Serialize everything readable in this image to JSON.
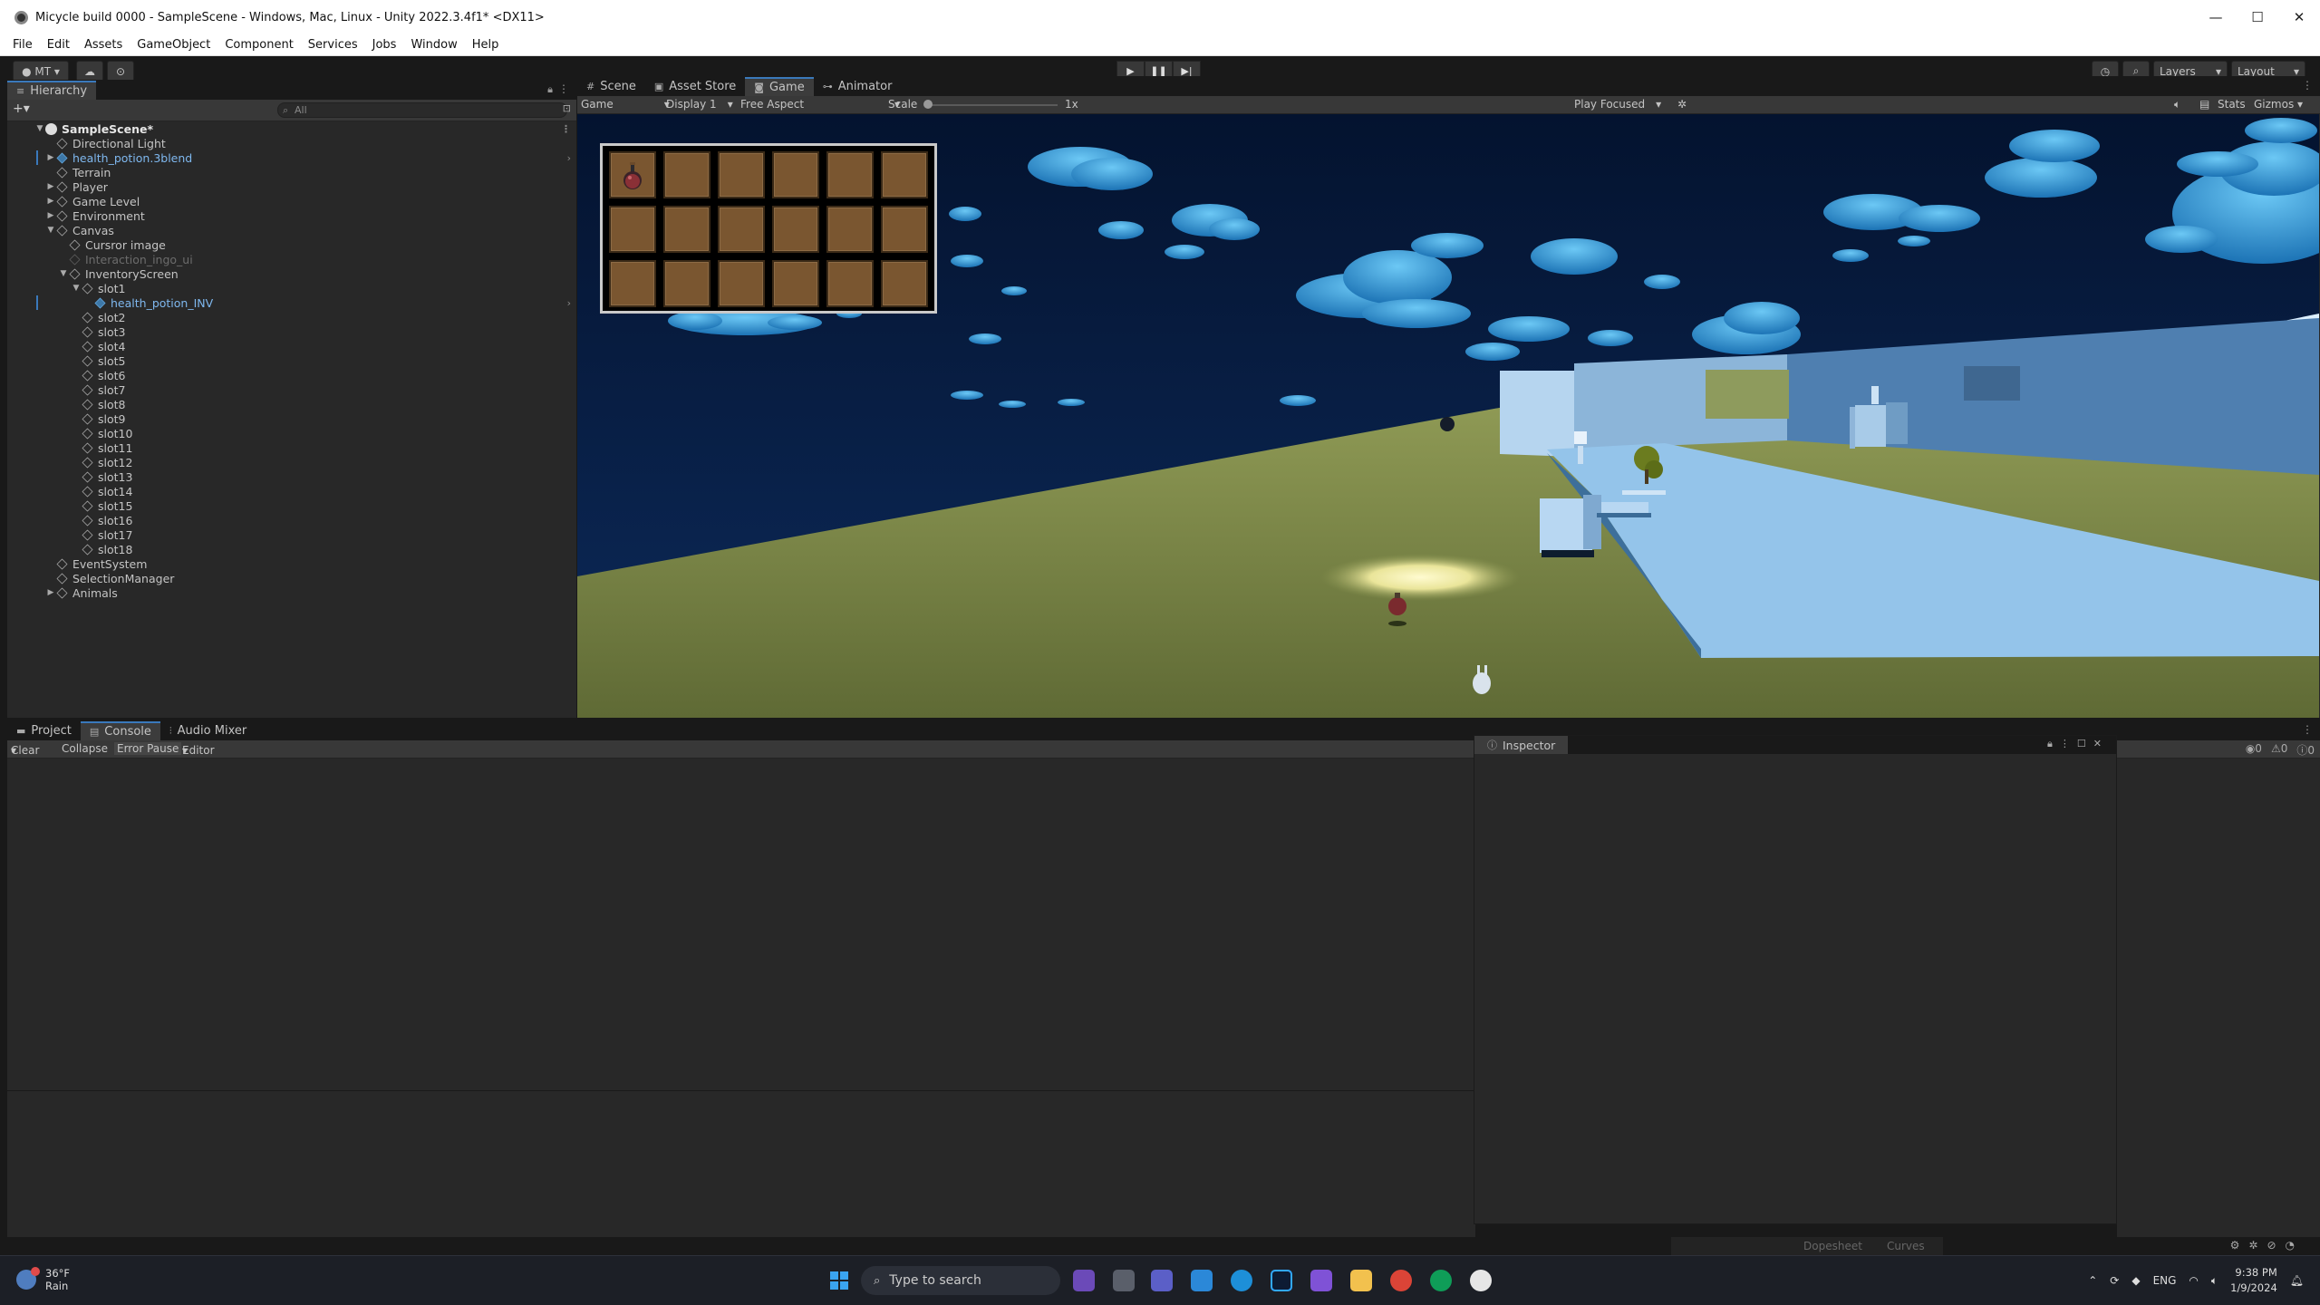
{
  "window": {
    "title": "Micycle build 0000 - SampleScene - Windows, Mac, Linux - Unity 2022.3.4f1* <DX11>",
    "minimize": "—",
    "maximize": "☐",
    "close": "✕"
  },
  "menu": [
    "File",
    "Edit",
    "Assets",
    "GameObject",
    "Component",
    "Services",
    "Jobs",
    "Window",
    "Help"
  ],
  "toolbar": {
    "account": "MT",
    "layers": "Layers",
    "layout": "Layout"
  },
  "hierarchy": {
    "tab": "Hierarchy",
    "search_placeholder": "All",
    "items": [
      {
        "label": "SampleScene*"
      },
      {
        "label": "Directional Light"
      },
      {
        "label": "health_potion.3blend"
      },
      {
        "label": "Terrain"
      },
      {
        "label": "Player"
      },
      {
        "label": "Game Level"
      },
      {
        "label": "Environment"
      },
      {
        "label": "Canvas"
      },
      {
        "label": "Cursror image"
      },
      {
        "label": "Interaction_ingo_ui"
      },
      {
        "label": "InventoryScreen"
      },
      {
        "label": "slot1"
      },
      {
        "label": "health_potion_INV"
      },
      {
        "label": "slot2"
      },
      {
        "label": "slot3"
      },
      {
        "label": "slot4"
      },
      {
        "label": "slot5"
      },
      {
        "label": "slot6"
      },
      {
        "label": "slot7"
      },
      {
        "label": "slot8"
      },
      {
        "label": "slot9"
      },
      {
        "label": "slot10"
      },
      {
        "label": "slot11"
      },
      {
        "label": "slot12"
      },
      {
        "label": "slot13"
      },
      {
        "label": "slot14"
      },
      {
        "label": "slot15"
      },
      {
        "label": "slot16"
      },
      {
        "label": "slot17"
      },
      {
        "label": "slot18"
      },
      {
        "label": "EventSystem"
      },
      {
        "label": "SelectionManager"
      },
      {
        "label": "Animals"
      }
    ]
  },
  "center_tabs": [
    "Scene",
    "Asset Store",
    "Game",
    "Animator"
  ],
  "game_toolbar": {
    "view": "Game",
    "display": "Display 1",
    "aspect": "Free Aspect",
    "scale_label": "Scale",
    "scale_value": "1x",
    "play_focused": "Play Focused",
    "stats": "Stats",
    "gizmos": "Gizmos"
  },
  "inventory": {
    "slots_filled": 1,
    "slot_count": 18
  },
  "bottom_tabs": [
    "Project",
    "Console",
    "Audio Mixer"
  ],
  "console": {
    "clear": "Clear",
    "collapse": "Collapse",
    "error_pause": "Error Pause",
    "editor": "Editor",
    "count_log": "0",
    "count_warn": "0",
    "count_err": "0"
  },
  "inspector": {
    "tab": "Inspector"
  },
  "status": {
    "dopesheet": "Dopesheet",
    "curves": "Curves"
  },
  "taskbar": {
    "temp": "36°F",
    "weather": "Rain",
    "search_placeholder": "Type to search",
    "lang": "ENG",
    "time": "9:38 PM",
    "date": "1/9/2024"
  },
  "colors": {
    "accent": "#3a79bb",
    "panel": "#282828",
    "slot": "#7a5630",
    "sky": "#061a3c"
  }
}
